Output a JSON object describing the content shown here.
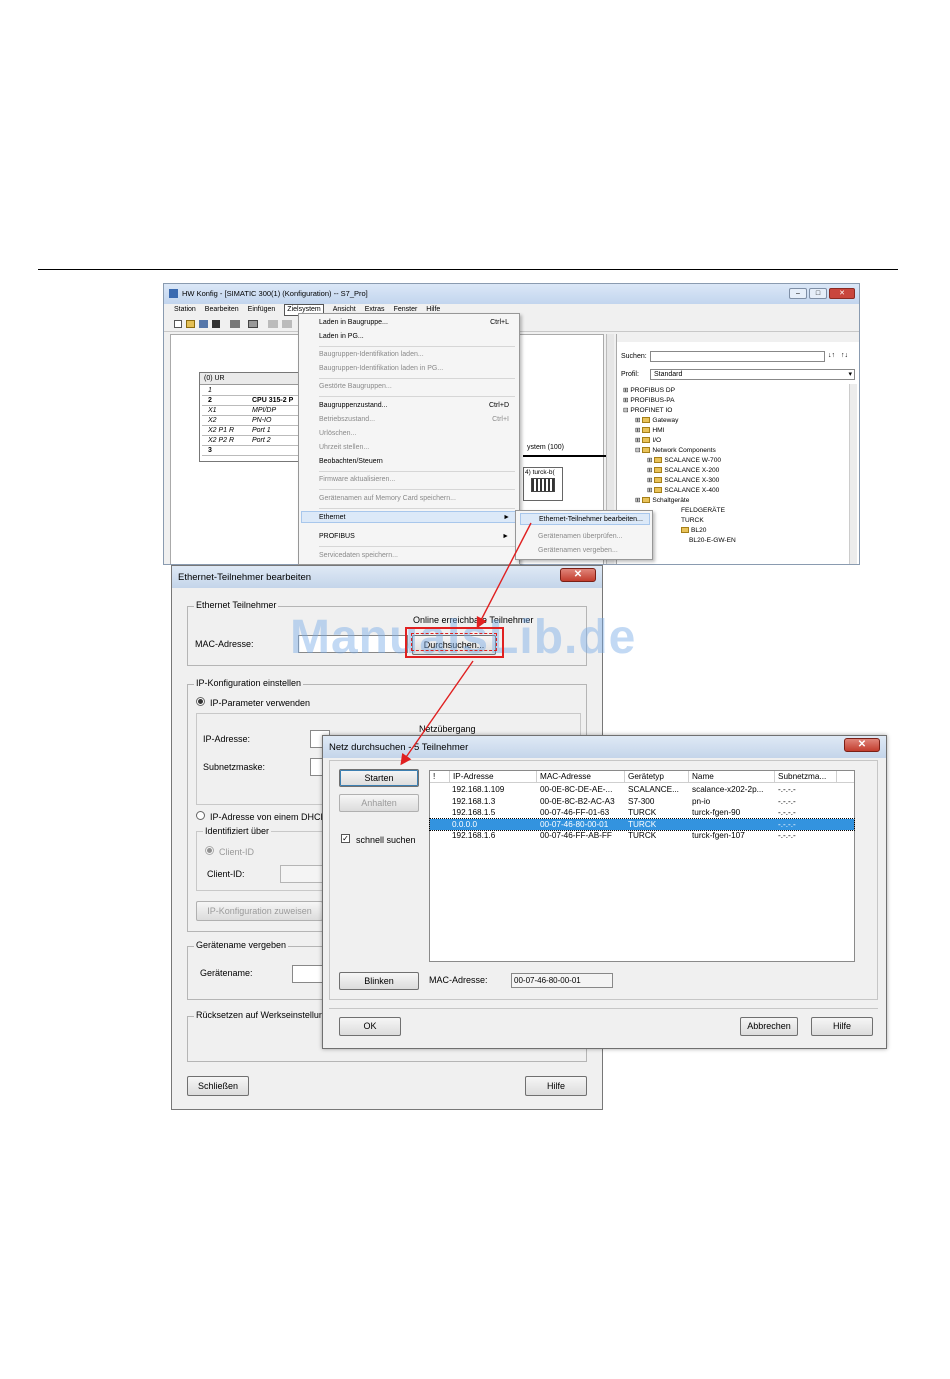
{
  "hw": {
    "title": "HW Konfig - [SIMATIC 300(1) (Konfiguration) -- S7_Pro]",
    "menu": [
      "Station",
      "Bearbeiten",
      "Einfügen",
      "Zielsystem",
      "Ansicht",
      "Extras",
      "Fenster",
      "Hilfe"
    ],
    "rack": {
      "title": "(0) UR",
      "rows": [
        {
          "slot": "1",
          "module": ""
        },
        {
          "slot": "2",
          "module": "CPU 315-2 P"
        },
        {
          "slot": "X1",
          "module": "MPI/DP"
        },
        {
          "slot": "X2",
          "module": "PN-IO"
        },
        {
          "slot": "X2 P1 R",
          "module": "Port 1"
        },
        {
          "slot": "X2 P2 R",
          "module": "Port 2"
        },
        {
          "slot": "3",
          "module": ""
        }
      ]
    },
    "network_label": "ystem (100)",
    "device_label": "4) turck-b(",
    "catalog": {
      "search_label": "Suchen:",
      "profile_label": "Profil:",
      "profile_value": "Standard",
      "tree": [
        "PROFIBUS DP",
        "PROFIBUS-PA",
        "PROFINET IO",
        "Gateway",
        "HMI",
        "I/O",
        "Network Components",
        "SCALANCE W-700",
        "SCALANCE X-200",
        "SCALANCE X-300",
        "SCALANCE X-400",
        "Schaltgeräte",
        "FELDGERÄTE",
        "TURCK",
        "BL20",
        "BL20-E-GW-EN"
      ]
    }
  },
  "zielsystem_menu": {
    "items": [
      {
        "label": "Laden in Baugruppe...",
        "key": "Ctrl+L",
        "disabled": false
      },
      {
        "label": "Laden in PG...",
        "key": "",
        "disabled": false
      },
      {
        "label": "Baugruppen-Identifikation laden...",
        "key": "",
        "disabled": true
      },
      {
        "label": "Baugruppen-Identifikation laden in PG...",
        "key": "",
        "disabled": true
      },
      {
        "label": "Gestörte Baugruppen...",
        "key": "",
        "disabled": true
      },
      {
        "label": "Baugruppenzustand...",
        "key": "Ctrl+D",
        "disabled": false
      },
      {
        "label": "Betriebszustand...",
        "key": "Ctrl+I",
        "disabled": true
      },
      {
        "label": "Urlöschen...",
        "key": "",
        "disabled": true
      },
      {
        "label": "Uhrzeit stellen...",
        "key": "",
        "disabled": true
      },
      {
        "label": "Beobachten/Steuern",
        "key": "",
        "disabled": false
      },
      {
        "label": "Firmware aktualisieren...",
        "key": "",
        "disabled": true
      },
      {
        "label": "Gerätenamen auf Memory Card speichern...",
        "key": "",
        "disabled": true
      },
      {
        "label": "Ethernet",
        "key": "►",
        "disabled": false
      },
      {
        "label": "PROFIBUS",
        "key": "►",
        "disabled": false
      },
      {
        "label": "Servicedaten speichern...",
        "key": "",
        "disabled": true
      }
    ],
    "submenu": [
      "Ethernet-Teilnehmer bearbeiten...",
      "Gerätenamen überprüfen...",
      "Gerätenamen vergeben..."
    ]
  },
  "eth_dialog": {
    "title": "Ethernet-Teilnehmer bearbeiten",
    "group_teilnehmer": "Ethernet Teilnehmer",
    "online_label": "Online erreichbare Teilnehmer",
    "mac_label": "MAC-Adresse:",
    "durchsuchen": "Durchsuchen...",
    "group_ip": "IP-Konfiguration einstellen",
    "radio_ip": "IP-Parameter verwenden",
    "netzuebergang": "Netzübergang",
    "ip_label": "IP-Adresse:",
    "subnet_label": "Subnetzmaske:",
    "radio_dhcp": "IP-Adresse von einem DHCP",
    "identifiziert": "Identifiziert über",
    "client_id_radio": "Client-ID",
    "client_id_label": "Client-ID:",
    "ip_zuweisen": "IP-Konfiguration zuweisen",
    "group_name": "Gerätename vergeben",
    "name_label": "Gerätename:",
    "group_reset": "Rücksetzen auf Werkseinstellun",
    "schliessen": "Schließen",
    "hilfe": "Hilfe"
  },
  "netz_dialog": {
    "title": "Netz durchsuchen - 5 Teilnehmer",
    "starten": "Starten",
    "anhalten": "Anhalten",
    "schnell_suchen": "schnell suchen",
    "schnell_checked": true,
    "blinken": "Blinken",
    "mac_label": "MAC-Adresse:",
    "mac_value": "00-07-46-80-00-01",
    "ok": "OK",
    "abbrechen": "Abbrechen",
    "hilfe": "Hilfe",
    "columns": [
      "!",
      "IP-Adresse",
      "MAC-Adresse",
      "Gerätetyp",
      "Name",
      "Subnetzma..."
    ],
    "rows": [
      [
        "",
        "192.168.1.109",
        "00-0E-8C-DE-AE-...",
        "SCALANCE...",
        "scalance-x202-2p...",
        "-.-.-.-"
      ],
      [
        "",
        "192.168.1.3",
        "00-0E-8C-B2-AC-A3",
        "S7-300",
        "pn-io",
        "-.-.-.-"
      ],
      [
        "",
        "192.168.1.5",
        "00-07-46-FF-01-63",
        "TURCK",
        "turck-fgen-90",
        "-.-.-.-"
      ],
      [
        "",
        "0.0.0.0",
        "00-07-46-80-00-01",
        "TURCK",
        "",
        "-.-.-.-"
      ],
      [
        "",
        "192.168.1.6",
        "00-07-46-FF-AB-FF",
        "TURCK",
        "turck-fgen-107",
        "-.-.-.-"
      ]
    ],
    "selected_row": 3
  },
  "watermark": "ManualsLib.de",
  "colors": {
    "selection": "#3393df",
    "annotation": "#e02020"
  }
}
